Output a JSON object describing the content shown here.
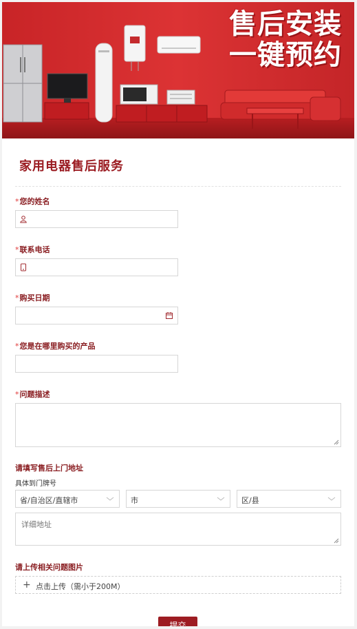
{
  "banner": {
    "headline_line1": "售后安装",
    "headline_line2": "一键预约",
    "colors": {
      "background": "#d42b2c",
      "floor": "#b51d20"
    }
  },
  "form": {
    "title": "家用电器售后服务",
    "required_mark": "*",
    "fields": {
      "name": {
        "label": "您的姓名",
        "icon": "user-icon"
      },
      "phone": {
        "label": "联系电话",
        "icon": "phone-icon"
      },
      "purchase_date": {
        "label": "购买日期",
        "icon": "calendar-icon"
      },
      "purchase_place": {
        "label": "您是在哪里购买的产品"
      },
      "problem": {
        "label": "问题描述"
      }
    },
    "address": {
      "label": "请填写售后上门地址",
      "sublabel": "具体到门牌号",
      "province_placeholder": "省/自治区/直辖市",
      "city_placeholder": "市",
      "district_placeholder": "区/县",
      "detail_placeholder": "详细地址"
    },
    "upload": {
      "label": "请上传相关问题图片",
      "button_text": "点击上传（需小于200M）"
    },
    "submit_label": "提交",
    "colors": {
      "accent": "#9b1c22",
      "required": "#e03a3a",
      "border": "#d6d6d6"
    }
  }
}
